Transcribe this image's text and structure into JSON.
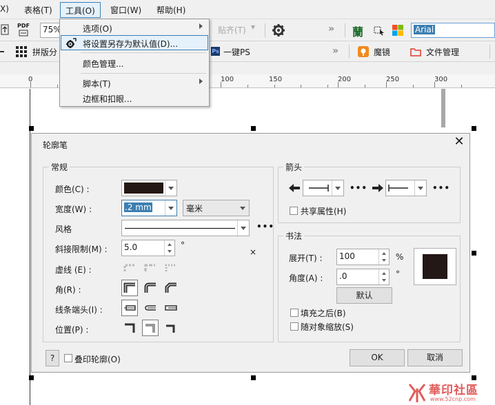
{
  "menubar": {
    "items": [
      {
        "label": "X)",
        "active": false
      },
      {
        "label": "表格(T)",
        "active": false
      },
      {
        "label": "工具(O)",
        "active": true
      },
      {
        "label": "窗口(W)",
        "active": false
      },
      {
        "label": "帮助(H)",
        "active": false
      }
    ]
  },
  "toolbar1": {
    "pdf_label": "PDF",
    "zoom_value": "75%",
    "paste_label": "贴齐(T)",
    "font_value": "Arial",
    "lan_glyph": "蘭"
  },
  "toolbar2": {
    "typeset_label": "拼版分",
    "ps_badge": "Ps",
    "oneclick_ps_label": "一键PS",
    "magic_mirror_label": "魔镜",
    "file_mgmt_label": "文件管理"
  },
  "ruler": {
    "labels": [
      "0",
      "100",
      "150",
      "200",
      "250",
      "300"
    ]
  },
  "tools_menu": {
    "items": [
      {
        "label": "选项(O)",
        "submenu": true
      },
      {
        "label": "将设置另存为默认值(D)...",
        "submenu": false
      },
      {
        "label": "颜色管理...",
        "submenu": false
      },
      {
        "label": "脚本(T)",
        "submenu": true
      },
      {
        "label": "边框和扣眼...",
        "submenu": false
      }
    ]
  },
  "dialog": {
    "title": "轮廓笔",
    "general": {
      "title": "常规",
      "color_label": "颜色(C) :",
      "color_swatch": "#231815",
      "width_label": "宽度(W) :",
      "width_value": ".2 mm",
      "unit_value": "毫米",
      "style_label": "风格",
      "miter_label": "斜接限制(M) :",
      "miter_value": "5.0",
      "miter_unit": "°",
      "dash_label": "虚线 (E) :",
      "corner_label": "角(R) :",
      "cap_label": "线条端头(I) :",
      "position_label": "位置(P) :"
    },
    "arrows": {
      "title": "箭头",
      "share_label": "共享属性(H)"
    },
    "calligraphy": {
      "title": "书法",
      "stretch_label": "展开(T) :",
      "stretch_value": "100",
      "stretch_unit": "%",
      "angle_label": "角度(A) :",
      "angle_value": ".0",
      "angle_unit": "°",
      "default_button": "默认",
      "fill_behind_label": "填充之后(B)",
      "scale_label": "随对象缩放(S)"
    },
    "help_button": "?",
    "overprint_label": "叠印轮廓(O)",
    "ok_button": "OK",
    "cancel_button": "取消",
    "x_mark": "×"
  },
  "watermark": {
    "text": "華印社區",
    "url": "www.52cnp.com",
    "color": "#e25a5a"
  },
  "colors": {
    "menu_highlight": "#e5f1fb",
    "menu_highlight_border": "#3c7fb1",
    "selection_blue": "#3c7fb1",
    "swatch": "#231815"
  }
}
